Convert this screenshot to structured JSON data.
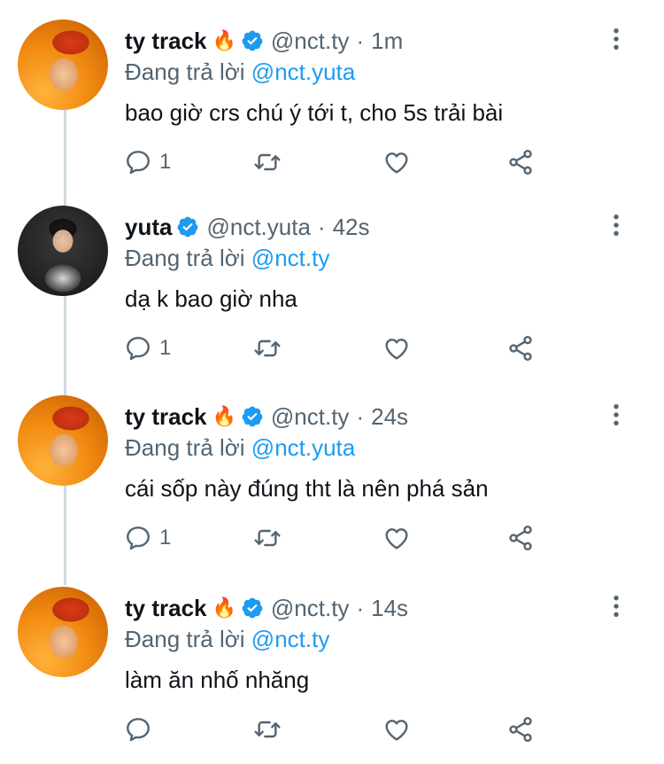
{
  "tweets": [
    {
      "name": "ty track",
      "emoji": "🔥",
      "handle": "@nct.ty",
      "time": "1m",
      "reply_prefix": "Đang trả lời",
      "reply_to": "@nct.yuta",
      "text": "bao giờ crs chú ý tới t, cho 5s trải bài",
      "reply_count": "1",
      "avatar": "ty-avatar"
    },
    {
      "name": "yuta",
      "emoji": "",
      "handle": "@nct.yuta",
      "time": "42s",
      "reply_prefix": "Đang trả lời",
      "reply_to": "@nct.ty",
      "text": "dạ k bao giờ nha",
      "reply_count": "1",
      "avatar": "yuta-avatar"
    },
    {
      "name": "ty track",
      "emoji": "🔥",
      "handle": "@nct.ty",
      "time": "24s",
      "reply_prefix": "Đang trả lời",
      "reply_to": "@nct.yuta",
      "text": "cái sốp này đúng tht là nên phá sản",
      "reply_count": "1",
      "avatar": "ty-avatar"
    },
    {
      "name": "ty track",
      "emoji": "🔥",
      "handle": "@nct.ty",
      "time": "14s",
      "reply_prefix": "Đang trả lời",
      "reply_to": "@nct.ty",
      "text": "làm ăn nhố nhăng",
      "reply_count": "",
      "avatar": "ty-avatar"
    }
  ],
  "separator": "·",
  "colors": {
    "link": "#1d9bf0",
    "secondary": "#536471",
    "verified": "#1d9bf0",
    "thread_line": "#cfd9de"
  }
}
